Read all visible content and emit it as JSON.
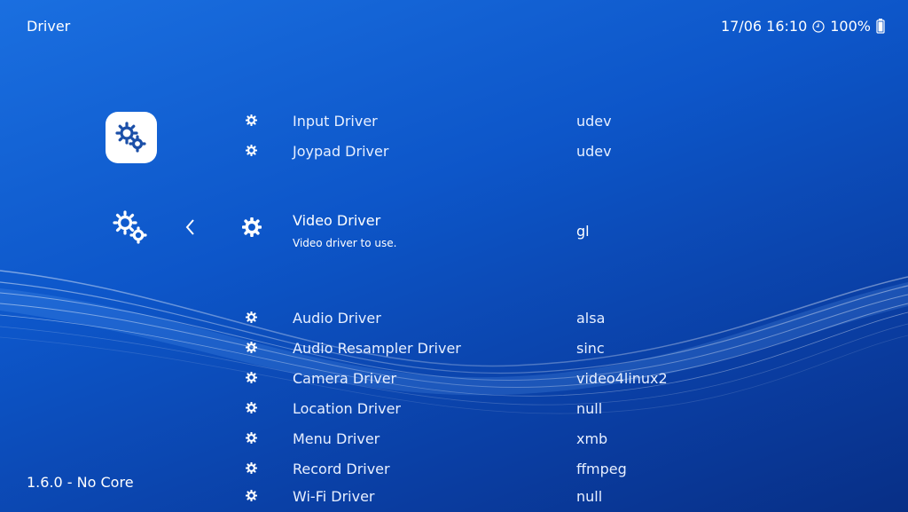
{
  "header": {
    "title": "Driver",
    "datetime": "17/06 16:10",
    "battery": "100%"
  },
  "footer": {
    "version": "1.6.0 - No Core"
  },
  "icons": {
    "main_category": "settings-gears-icon",
    "sub_category": "settings-gears-icon",
    "back": "chevron-left-icon",
    "row": "gear-icon",
    "clock": "clock-icon",
    "battery": "battery-icon"
  },
  "colors": {
    "background_top": "#1a6fe0",
    "background_bottom": "#082f86",
    "text": "#ffffff",
    "icon_accent": "#1b4fa8"
  },
  "menu": {
    "items": [
      {
        "label": "Input Driver",
        "value": "udev"
      },
      {
        "label": "Joypad Driver",
        "value": "udev"
      },
      {
        "label": "Video Driver",
        "value": "gl",
        "sublabel": "Video driver to use."
      },
      {
        "label": "Audio Driver",
        "value": "alsa"
      },
      {
        "label": "Audio Resampler Driver",
        "value": "sinc"
      },
      {
        "label": "Camera Driver",
        "value": "video4linux2"
      },
      {
        "label": "Location Driver",
        "value": "null"
      },
      {
        "label": "Menu Driver",
        "value": "xmb"
      },
      {
        "label": "Record Driver",
        "value": "ffmpeg"
      },
      {
        "label": "Wi-Fi Driver",
        "value": "null"
      }
    ]
  }
}
